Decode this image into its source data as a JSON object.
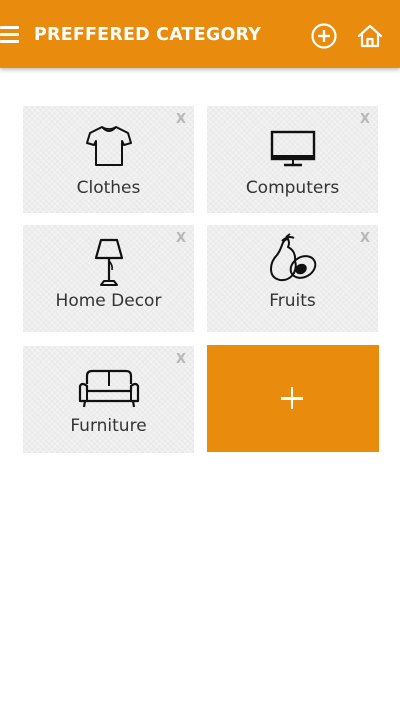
{
  "header": {
    "title": "PREFFERED CATEGORY",
    "menu_icon": "hamburger-menu-icon",
    "add_icon": "add-circle-icon",
    "home_icon": "home-icon",
    "bar_color": "#e98b0c"
  },
  "categories": [
    {
      "label": "Clothes",
      "icon": "tshirt-icon",
      "remove_label": "X"
    },
    {
      "label": "Computers",
      "icon": "monitor-icon",
      "remove_label": "X"
    },
    {
      "label": "Home Decor",
      "icon": "lamp-icon",
      "remove_label": "X"
    },
    {
      "label": "Fruits",
      "icon": "avocado-icon",
      "remove_label": "X"
    },
    {
      "label": "Furniture",
      "icon": "sofa-icon",
      "remove_label": "X"
    }
  ],
  "add_tile": {
    "icon": "plus-icon",
    "color": "#e98b0c"
  }
}
